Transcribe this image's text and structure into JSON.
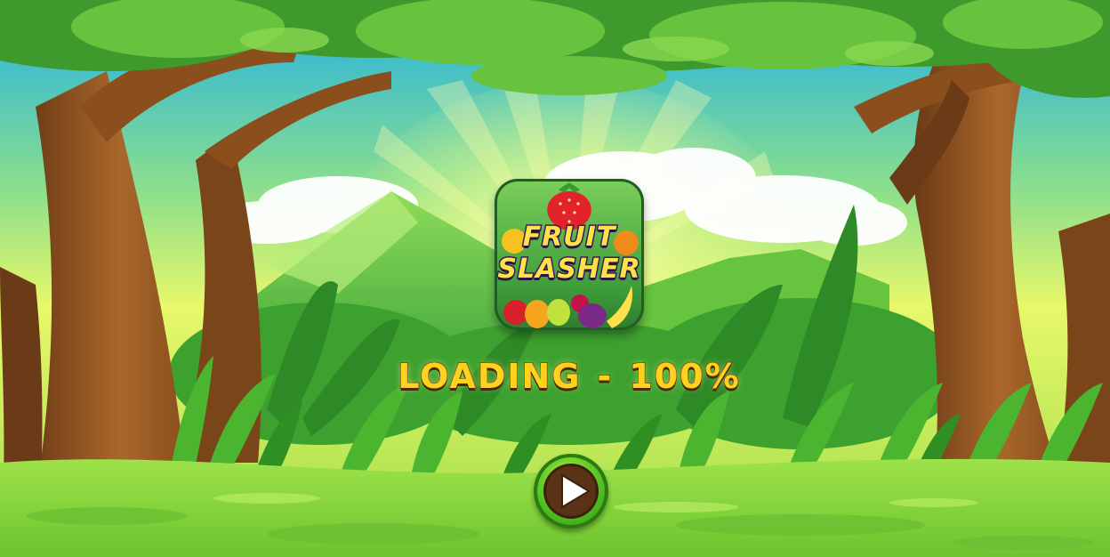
{
  "game": {
    "logo": {
      "line1": "FRUIT",
      "line2": "SLASHER"
    },
    "loading": {
      "label": "LOADING",
      "separator": "-",
      "percent": "100%",
      "progress": 1.0
    },
    "play_button": {
      "icon": "play-icon"
    }
  },
  "colors": {
    "sky": "#2fb6e8",
    "grass": "#7cc83a",
    "title_text": "#ffd21e",
    "play_button": "#4fbf20"
  }
}
